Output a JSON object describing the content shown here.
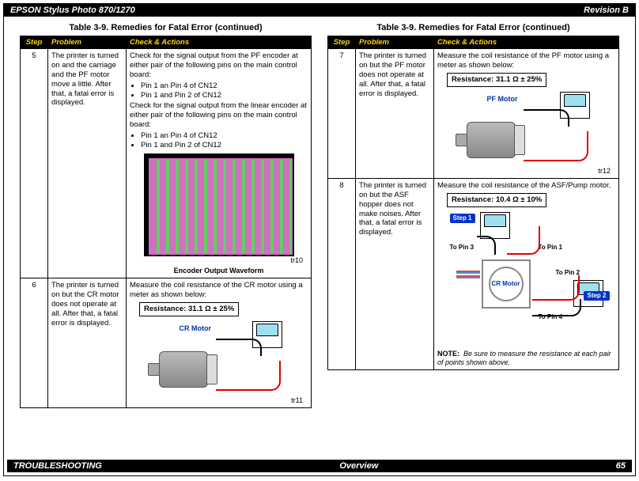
{
  "header": {
    "title": "EPSON Stylus Photo 870/1270",
    "revision": "Revision B"
  },
  "footer": {
    "section": "TROUBLESHOOTING",
    "subsection": "Overview",
    "page": "65"
  },
  "tableTitle": "Table 3-9.  Remedies for Fatal Error (continued)",
  "th": {
    "step": "Step",
    "problem": "Problem",
    "check": "Check & Actions"
  },
  "row5": {
    "step": "5",
    "problem": "The printer is turned on and the carriage and the PF motor move a little. After that, a fatal error is displayed.",
    "check1": "Check for the signal output from the PF encoder at either pair of the following pins on the main control board:",
    "b1": "Pin 1 an Pin 4 of CN12",
    "b2": "Pin 1 and Pin 2 of CN12",
    "check2": "Check for the signal output from the linear encoder at either pair of the following pins on the main control board:",
    "b3": "Pin 1 an Pin 4 of CN12",
    "b4": "Pin 1 and Pin 2 of CN12",
    "caption": "Encoder Output Waveform",
    "tr": "tr10"
  },
  "row6": {
    "step": "6",
    "problem": "The printer is turned on but the CR motor does not operate at all. After that, a fatal error is displayed.",
    "check": "Measure the coil resistance of the CR motor using a meter as shown below:",
    "resistance": "Resistance: 31.1 Ω ± 25%",
    "motorLabel": "CR Motor",
    "tr": "tr11"
  },
  "row7": {
    "step": "7",
    "problem": "The printer is turned on but the PF motor does not operate at all. After that, a fatal error is displayed.",
    "check": "Measure the coil resistance of the PF motor using a meter as shown below:",
    "resistance": "Resistance: 31.1 Ω ± 25%",
    "motorLabel": "PF Motor",
    "tr": "tr12"
  },
  "row8": {
    "step": "8",
    "problem": "The printer is turned on but the ASF hopper does not make noises. After that, a fatal error is displayed.",
    "check": "Measure the coil resistance of the ASF/Pump motor.",
    "resistance": "Resistance: 10.4 Ω ± 10%",
    "step1": "Step 1",
    "step2": "Step 2",
    "pin1": "To Pin 1",
    "pin2": "To Pin 2",
    "pin3": "To Pin 3",
    "pin4": "To Pin 4",
    "crLabel": "CR Motor",
    "noteLabel": "NOTE:",
    "note": "Be sure to measure the resistance at each pair of points shown above."
  }
}
